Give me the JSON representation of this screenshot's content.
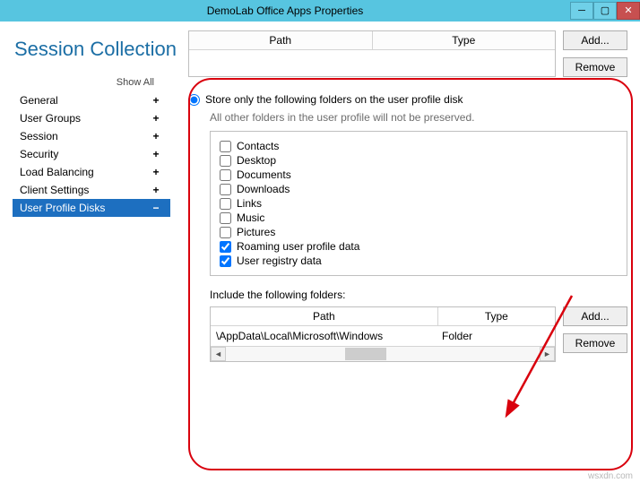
{
  "titlebar": {
    "title": "DemoLab Office Apps Properties"
  },
  "heading": "Session Collection",
  "showall": "Show All",
  "nav": [
    {
      "label": "General",
      "exp": "+"
    },
    {
      "label": "User Groups",
      "exp": "+"
    },
    {
      "label": "Session",
      "exp": "+"
    },
    {
      "label": "Security",
      "exp": "+"
    },
    {
      "label": "Load Balancing",
      "exp": "+"
    },
    {
      "label": "Client Settings",
      "exp": "+"
    },
    {
      "label": "User Profile Disks",
      "exp": "−"
    }
  ],
  "topTable": {
    "headers": {
      "path": "Path",
      "type": "Type"
    },
    "buttons": {
      "add": "Add...",
      "remove": "Remove"
    }
  },
  "storeOption": {
    "label": "Store only the following folders on the user profile disk",
    "hint": "All other folders in the user profile will not be preserved."
  },
  "folders": [
    {
      "label": "Contacts",
      "checked": false
    },
    {
      "label": "Desktop",
      "checked": false
    },
    {
      "label": "Documents",
      "checked": false
    },
    {
      "label": "Downloads",
      "checked": false
    },
    {
      "label": "Links",
      "checked": false
    },
    {
      "label": "Music",
      "checked": false
    },
    {
      "label": "Pictures",
      "checked": false
    },
    {
      "label": "Roaming user profile data",
      "checked": true
    },
    {
      "label": "User registry data",
      "checked": true
    }
  ],
  "include": {
    "label": "Include the following folders:",
    "headers": {
      "path": "Path",
      "type": "Type"
    },
    "rows": [
      {
        "path": "\\AppData\\Local\\Microsoft\\Windows",
        "type": "Folder"
      }
    ],
    "buttons": {
      "add": "Add...",
      "remove": "Remove"
    }
  },
  "watermark": "wsxdn.com"
}
